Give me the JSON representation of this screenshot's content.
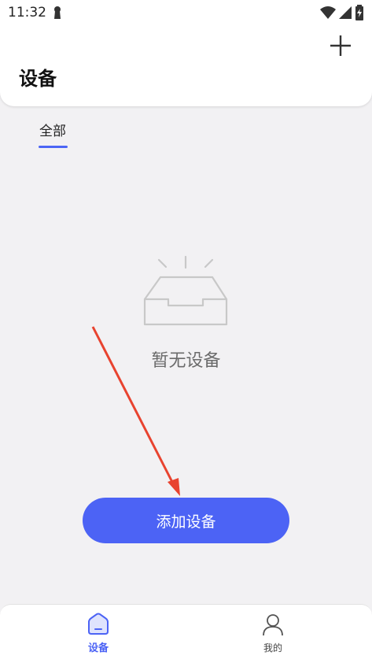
{
  "status_bar": {
    "time": "11:32"
  },
  "header": {
    "title": "设备"
  },
  "tabs": [
    {
      "label": "全部"
    }
  ],
  "empty_state": {
    "message": "暂无设备"
  },
  "primary_button": {
    "label": "添加设备"
  },
  "bottom_nav": [
    {
      "label": "设备",
      "icon": "home-icon",
      "active": true
    },
    {
      "label": "我的",
      "icon": "user-icon",
      "active": false
    }
  ],
  "colors": {
    "accent": "#4c63f5",
    "background": "#f2f1f3",
    "annotation": "#e8432f"
  }
}
